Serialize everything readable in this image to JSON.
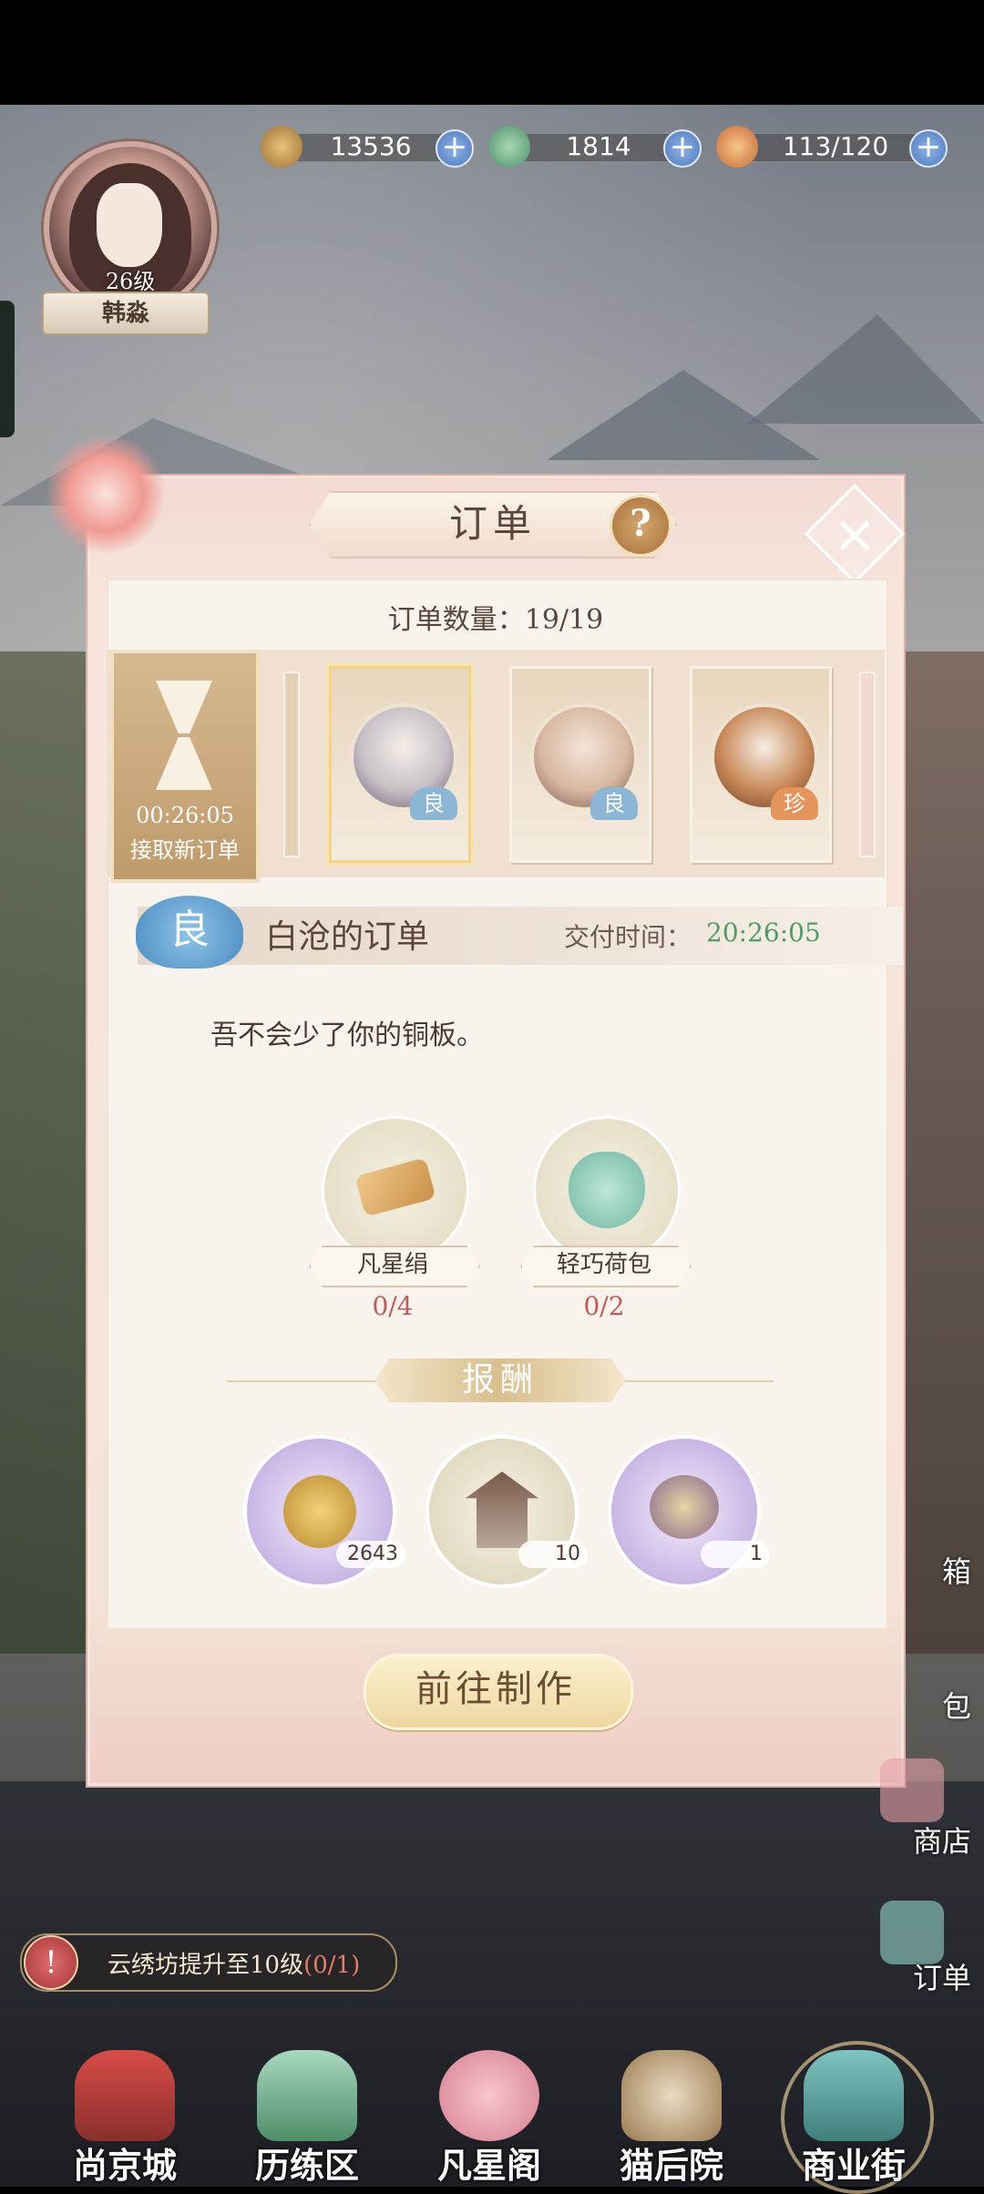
{
  "resources": [
    {
      "icon": "paw-coin-icon",
      "value": "13536"
    },
    {
      "icon": "jade-frog-icon",
      "value": "1814"
    },
    {
      "icon": "bun-stamina-icon",
      "value": "113/120"
    }
  ],
  "player": {
    "level": "26级",
    "name": "韩淼"
  },
  "dialog": {
    "title": "订单",
    "help": "?",
    "close": "×",
    "order_count_label": "订单数量：19/19",
    "new_order": {
      "timer": "00:26:05",
      "label": "接取新订单"
    },
    "cards": [
      {
        "grade": "良",
        "character": "white-haired-man"
      },
      {
        "grade": "良",
        "character": "old-woman"
      },
      {
        "grade": "珍",
        "character": "cat"
      }
    ],
    "detail": {
      "grade": "良",
      "title": "白沧的订单",
      "deliver_label": "交付时间：",
      "deliver_time": "20:26:05",
      "quote": "吾不会少了你的铜板。"
    },
    "requirements": [
      {
        "name": "凡星绢",
        "progress": "0/4",
        "icon": "silk-scroll-icon"
      },
      {
        "name": "轻巧荷包",
        "progress": "0/2",
        "icon": "pouch-icon"
      }
    ],
    "reward_title": "报酬",
    "rewards": [
      {
        "icon": "paw-coin-icon",
        "qty": "2643"
      },
      {
        "icon": "pavilion-icon",
        "qty": "10"
      },
      {
        "icon": "flower-hairpin-icon",
        "qty": "1"
      }
    ],
    "make_button": "前往制作"
  },
  "side_menu": [
    "箱",
    "包",
    "商店",
    "订单"
  ],
  "quest": {
    "text": "云绣坊提升至10级",
    "progress": "(0/1)",
    "icon_text": "!"
  },
  "nav": [
    "尚京城",
    "历练区",
    "凡星阁",
    "猫后院",
    "商业街"
  ],
  "colors": {
    "accent_green": "#4e9d62",
    "progress_red": "#c35a5a",
    "grade_blue": "#8bb6d6",
    "grade_orange": "#e5955c"
  }
}
